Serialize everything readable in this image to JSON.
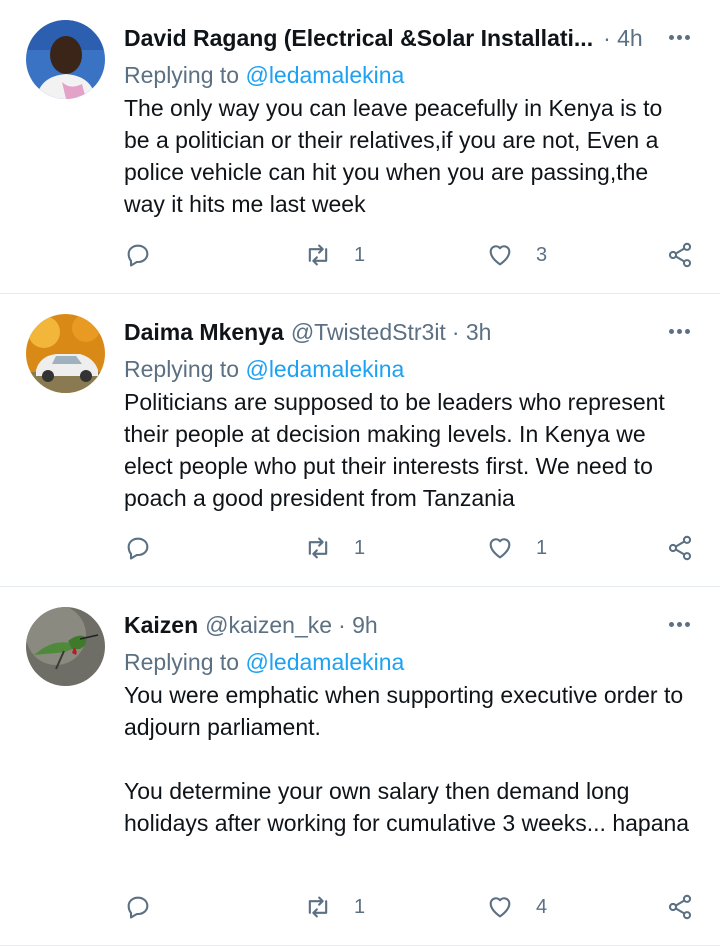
{
  "tweets": [
    {
      "name": "David Ragang (Electrical &Solar Installati...",
      "handle": "",
      "time": "· 4h",
      "reply_prefix": "Replying to",
      "reply_to": "@ledamalekina",
      "text": "The only way you can leave peacefully in Kenya is to be a politician or their relatives,if you are not, Even a police vehicle can hit you when you are passing,the way it hits me last week",
      "retweets": "1",
      "likes": "3"
    },
    {
      "name": "Daima Mkenya",
      "handle": "@TwistedStr3it",
      "time": "· 3h",
      "reply_prefix": "Replying to",
      "reply_to": "@ledamalekina",
      "text": "Politicians are supposed to be leaders who represent their people at decision making levels. In Kenya we elect people who put their interests first. We need to poach a good president from Tanzania",
      "retweets": "1",
      "likes": "1"
    },
    {
      "name": "Kaizen",
      "handle": "@kaizen_ke",
      "time": "· 9h",
      "reply_prefix": "Replying to",
      "reply_to": "@ledamalekina",
      "text": "You were emphatic when supporting executive order to adjourn parliament.\n\nYou determine your own salary then demand long holidays after working for cumulative 3 weeks... hapana",
      "retweets": "1",
      "likes": "4"
    }
  ],
  "colors": {
    "accent": "#1da1f2",
    "muted": "#5b7083",
    "divider": "#e6ecf0"
  },
  "icons": [
    "more-icon",
    "reply-icon",
    "retweet-icon",
    "like-icon",
    "share-icon"
  ]
}
